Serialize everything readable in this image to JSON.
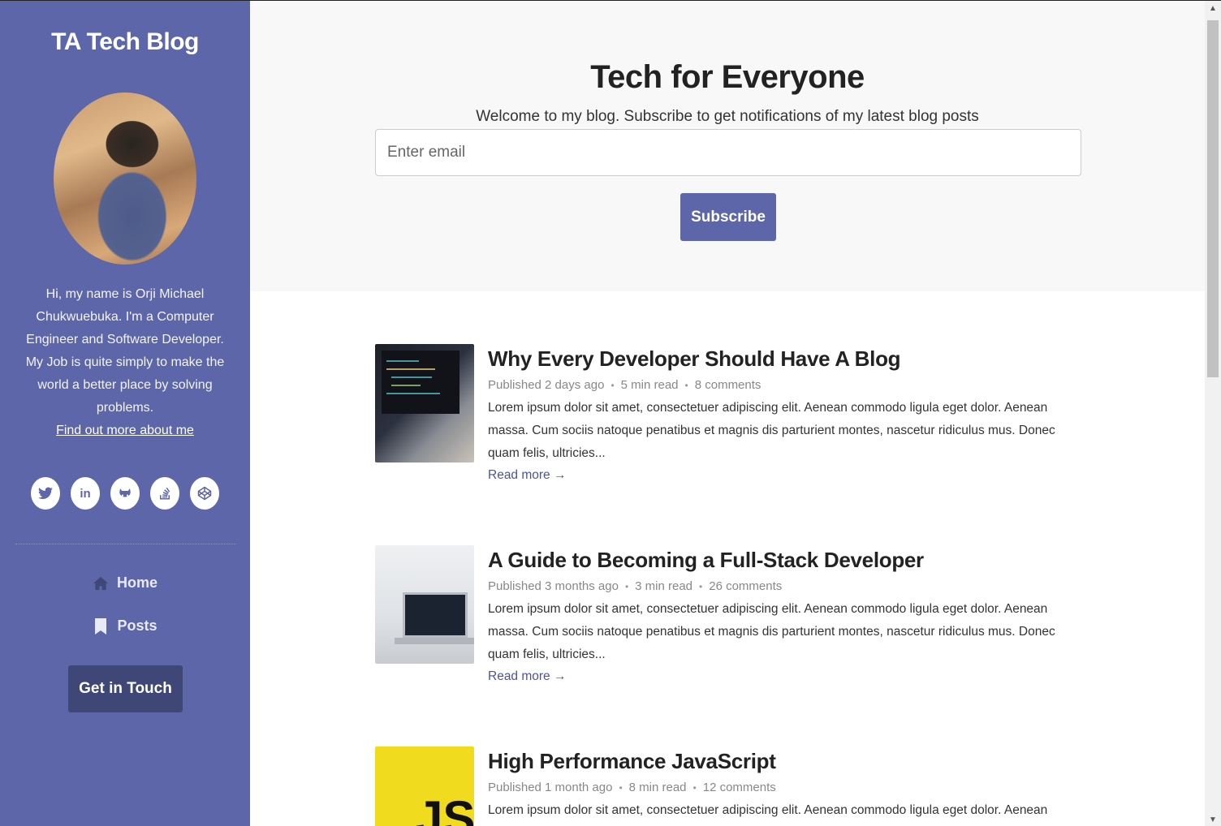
{
  "sidebar": {
    "blog_name": "TA Tech Blog",
    "bio_lines": [
      "Hi, my name is Orji Michael Chukwuebuka. I'm a Computer Engineer and Software Developer.",
      "My Job is quite simply to make the world a better place by solving problems."
    ],
    "about_link": "Find out more about me",
    "socials": [
      {
        "name": "twitter-icon",
        "glyph": "t"
      },
      {
        "name": "linkedin-icon",
        "glyph": "in"
      },
      {
        "name": "github-icon",
        "glyph": "◉"
      },
      {
        "name": "stackoverflow-icon",
        "glyph": "≡"
      },
      {
        "name": "codepen-icon",
        "glyph": "◈"
      }
    ],
    "nav": {
      "home": "Home",
      "posts": "Posts"
    },
    "cta": "Get in Touch"
  },
  "hero": {
    "title": "Tech for Everyone",
    "subtitle": "Welcome to my blog. Subscribe to get notifications of my latest blog posts",
    "email_placeholder": "Enter email",
    "subscribe_label": "Subscribe"
  },
  "posts": [
    {
      "title": "Why Every Developer Should Have A Blog",
      "published": "Published 2 days ago",
      "read_time": "5 min read",
      "comments": "8 comments",
      "excerpt": "Lorem ipsum dolor sit amet, consectetuer adipiscing elit. Aenean commodo ligula eget dolor. Aenean massa. Cum sociis natoque penatibus et magnis dis parturient montes, nascetur ridiculus mus. Donec quam felis, ultricies...",
      "read_more": "Read more →"
    },
    {
      "title": "A Guide to Becoming a Full-Stack Developer",
      "published": "Published 3 months ago",
      "read_time": "3 min read",
      "comments": "26 comments",
      "excerpt": "Lorem ipsum dolor sit amet, consectetuer adipiscing elit. Aenean commodo ligula eget dolor. Aenean massa. Cum sociis natoque penatibus et magnis dis parturient montes, nascetur ridiculus mus. Donec quam felis, ultricies...",
      "read_more": "Read more →"
    },
    {
      "title": "High Performance JavaScript",
      "published": "Published 1 month ago",
      "read_time": "8 min read",
      "comments": "12 comments",
      "excerpt": "Lorem ipsum dolor sit amet, consectetuer adipiscing elit. Aenean commodo ligula eget dolor. Aenean massa.",
      "thumb_text": "JS"
    }
  ],
  "colors": {
    "sidebar": "#5c66a8",
    "cta_dark": "#3f4776",
    "hero_bg": "#f8f8f8",
    "link": "#4a5596"
  }
}
